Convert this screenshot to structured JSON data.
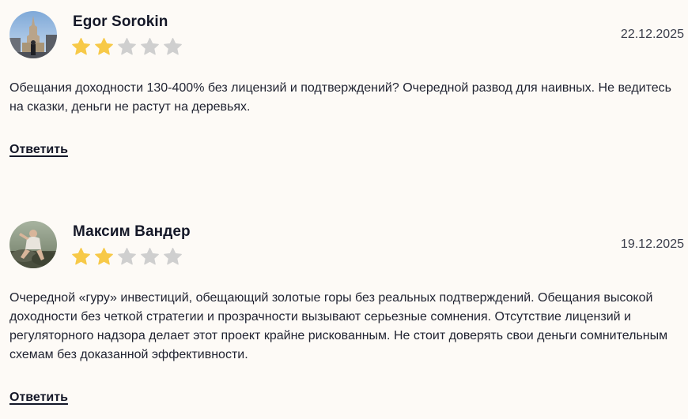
{
  "reviews": [
    {
      "author": "Egor Sorokin",
      "rating": 2,
      "max_rating": 5,
      "date": "22.12.2025",
      "text": "Обещания доходности 130-400% без лицензий и подтверждений? Очередной развод для наивных. Не ведитесь на сказки, деньги не растут на деревьях.",
      "reply_label": "Ответить"
    },
    {
      "author": "Максим Вандер",
      "rating": 2,
      "max_rating": 5,
      "date": "19.12.2025",
      "text": "Очередной «гуру» инвестиций, обещающий золотые горы без реальных подтверждений. Обещания высокой доходности без четкой стратегии и прозрачности вызывают серьезные сомнения. Отсутствие лицензий и регуляторного надзора делает этот проект крайне рискованным. Не стоит доверять свои деньги сомнительным схемам без доказанной эффективности.",
      "reply_label": "Ответить"
    }
  ],
  "colors": {
    "star_filled": "#f7c948",
    "star_empty": "#cfcfcf",
    "background": "#fdfaf6"
  },
  "icons": {
    "star": "star-icon"
  }
}
